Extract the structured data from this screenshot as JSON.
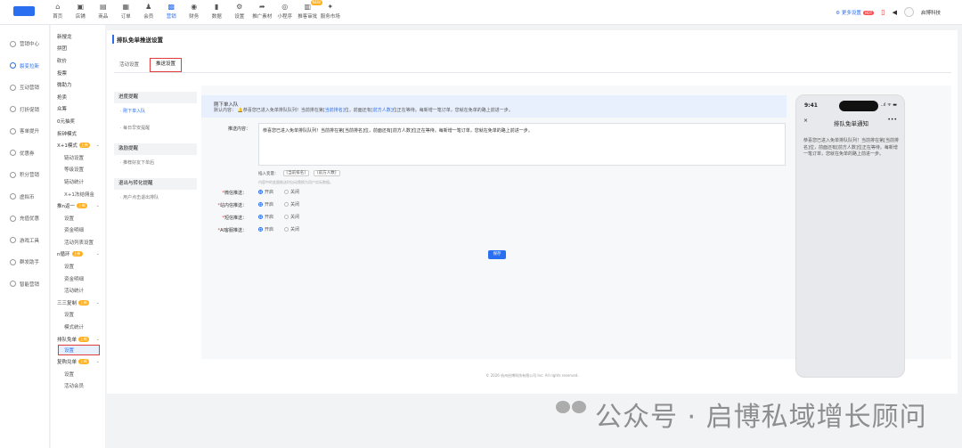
{
  "topnav": {
    "items": [
      {
        "icon": "home-icon",
        "glyph": "⌂",
        "label": "首页"
      },
      {
        "icon": "store-icon",
        "glyph": "▣",
        "label": "店铺"
      },
      {
        "icon": "goods-icon",
        "glyph": "▤",
        "label": "商品"
      },
      {
        "icon": "order-icon",
        "glyph": "▦",
        "label": "订单"
      },
      {
        "icon": "member-icon",
        "glyph": "♟",
        "label": "会员"
      },
      {
        "icon": "marketing-icon",
        "glyph": "▩",
        "label": "营销"
      },
      {
        "icon": "finance-icon",
        "glyph": "◉",
        "label": "财务"
      },
      {
        "icon": "data-icon",
        "glyph": "▮",
        "label": "数据"
      },
      {
        "icon": "settings-icon",
        "glyph": "⚙",
        "label": "设置"
      },
      {
        "icon": "promo-icon",
        "glyph": "➦",
        "label": "推广素材"
      },
      {
        "icon": "miniapp-icon",
        "glyph": "◎",
        "label": "小程序"
      },
      {
        "icon": "review-icon",
        "glyph": "▥",
        "label": "推客审批"
      },
      {
        "icon": "market-icon",
        "glyph": "✦",
        "label": "服务市场"
      }
    ],
    "active_index": 5,
    "badge": "NEW",
    "upgrade_label": "更多设置",
    "upgrade_tag": "HOT",
    "company": "启博科技"
  },
  "sidebar_primary": [
    {
      "label": "营销中心",
      "active": false
    },
    {
      "label": "裂变拉新",
      "active": true
    },
    {
      "label": "互动营销",
      "active": false
    },
    {
      "label": "打折促销",
      "active": false
    },
    {
      "label": "客单提升",
      "active": false
    },
    {
      "label": "优惠券",
      "active": false
    },
    {
      "label": "积分营销",
      "active": false
    },
    {
      "label": "虚拟币",
      "active": false
    },
    {
      "label": "充值优惠",
      "active": false
    },
    {
      "label": "游戏工具",
      "active": false
    },
    {
      "label": "群发助手",
      "active": false
    },
    {
      "label": "智能营销",
      "active": false
    }
  ],
  "sidebar_secondary": [
    {
      "label": "新搜龙",
      "type": "top"
    },
    {
      "label": "拼团",
      "type": "top"
    },
    {
      "label": "砍价",
      "type": "top"
    },
    {
      "label": "投票",
      "type": "top"
    },
    {
      "label": "微助力",
      "type": "top"
    },
    {
      "label": "抢卖",
      "type": "top"
    },
    {
      "label": "众筹",
      "type": "top"
    },
    {
      "label": "0元抽奖",
      "type": "top"
    },
    {
      "label": "拆钟模式",
      "type": "top"
    },
    {
      "label": "X+1模式",
      "type": "group",
      "tag": "上新"
    },
    {
      "label": "链动设置",
      "type": "sub"
    },
    {
      "label": "等级设置",
      "type": "sub"
    },
    {
      "label": "链动统计",
      "type": "sub"
    },
    {
      "label": "X+1冻结佣金",
      "type": "sub"
    },
    {
      "label": "推n返一",
      "type": "group",
      "tag": "上新"
    },
    {
      "label": "设置",
      "type": "sub"
    },
    {
      "label": "资金明细",
      "type": "sub"
    },
    {
      "label": "活动列表设置",
      "type": "sub"
    },
    {
      "label": "n循环",
      "type": "group",
      "tag": "上新"
    },
    {
      "label": "设置",
      "type": "sub"
    },
    {
      "label": "资金明细",
      "type": "sub"
    },
    {
      "label": "活动统计",
      "type": "sub"
    },
    {
      "label": "三三复制",
      "type": "group",
      "tag": "上新"
    },
    {
      "label": "设置",
      "type": "sub"
    },
    {
      "label": "模式统计",
      "type": "sub"
    },
    {
      "label": "排队免单",
      "type": "group",
      "tag": "上新"
    },
    {
      "label": "设置",
      "type": "sub",
      "active": true
    },
    {
      "label": "复购兑单",
      "type": "group",
      "tag": "上新"
    },
    {
      "label": "设置",
      "type": "sub"
    },
    {
      "label": "活动会员",
      "type": "sub"
    }
  ],
  "page": {
    "title": "排队免单推送设置",
    "tabs": [
      {
        "label": "活动设置",
        "active": false
      },
      {
        "label": "推送设置",
        "active": true
      }
    ]
  },
  "push_menu": [
    {
      "head": "进度提醒",
      "items": [
        {
          "label": "· 刚下单入队",
          "active": true
        },
        {
          "label": "· 每日早安提醒",
          "active": false
        }
      ]
    },
    {
      "head": "激励提醒",
      "items": [
        {
          "label": "· 推荐好友下单后",
          "active": false
        }
      ]
    },
    {
      "head": "退出与转化提醒",
      "items": [
        {
          "label": "· 用户点击退出排队",
          "active": false
        }
      ]
    }
  ],
  "config": {
    "section_title": "刚下单入队",
    "default_label": "默认内容：",
    "default_text_pre": "恭喜您已进入免单排队队列！当前排在第",
    "default_var1": "[当前排名]",
    "default_text_mid": "位，前面还有",
    "default_var2": "[前方人数]",
    "default_text_post": "位正在等待。每新增一笔订单，您就在免单的路上前进一步。",
    "content_label": "推送内容：",
    "content_value": "恭喜您已进入免单排队队列！当前排在第[当前排名]位，前面还有[前方人数]位正在等待。每新增一笔订单，您就在免单的路上前进一步。",
    "insert_label": "插入变量：",
    "var_chip1": "[当前排名]",
    "var_chip2": "[前方人数]",
    "hint": "内容中的变量推送时自动替换为用户实际数据。",
    "channels": [
      {
        "label": "微信推送：",
        "on": "开启",
        "off": "关闭"
      },
      {
        "label": "站内信推送：",
        "on": "开启",
        "off": "关闭"
      },
      {
        "label": "短信推送：",
        "on": "开启",
        "off": "关闭"
      },
      {
        "label": "AI客服推送：",
        "on": "开启",
        "off": "关闭"
      }
    ],
    "save_label": "保存"
  },
  "phone": {
    "time": "9:41",
    "status": "..ıl ᯤ ▬",
    "close": "×",
    "title": "排队免单通知",
    "more": "•••",
    "body": "恭喜您已进入免单排队队列！当前排在第[当前排名]位，前面还有[前方人数]位正在等待。每新增一笔订单，您就在免单的路上前进一步。"
  },
  "footer": "© 2026 杭州启博科技有限公司 Inc. All rights reserved.",
  "watermark": "公众号 · 启博私域增长顾问",
  "colors": {
    "accent": "#2a6ff0",
    "highlight_border": "#e03c3c",
    "badge": "#ffb020"
  }
}
